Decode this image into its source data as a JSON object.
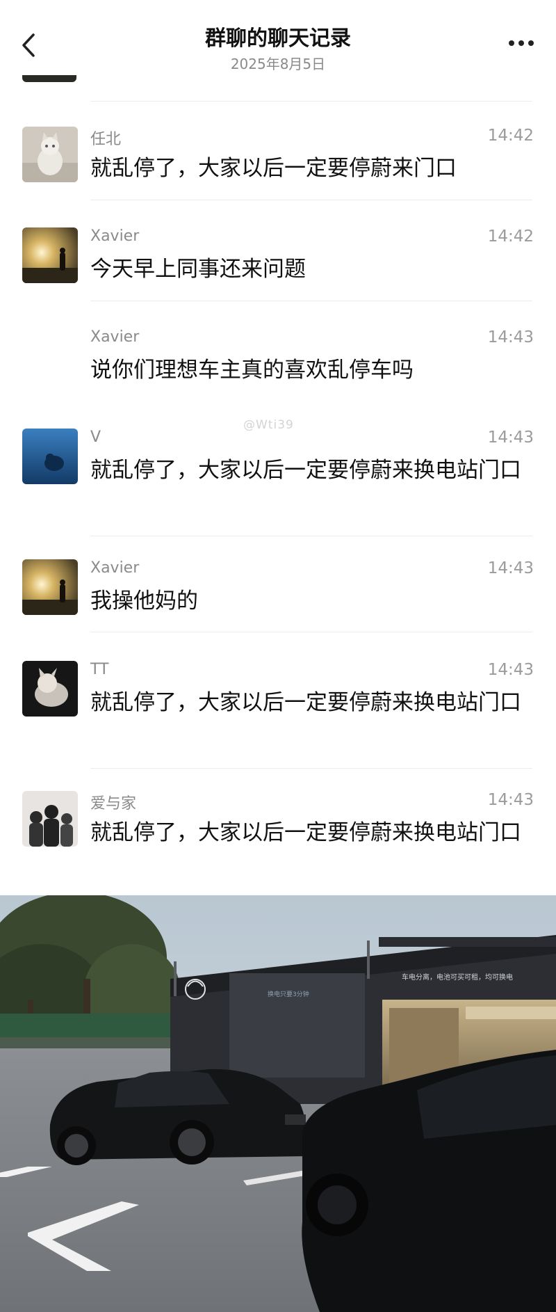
{
  "header": {
    "title": "群聊的聊天记录",
    "date": "2025年8月5日"
  },
  "watermark": "@Wti39",
  "messages": [
    {
      "sender": "任北",
      "time": "14:42",
      "text": "就乱停了，大家以后一定要停蔚来门口"
    },
    {
      "sender": "Xavier",
      "time": "14:42",
      "text": "今天早上同事还来问题"
    },
    {
      "sender": "Xavier",
      "time": "14:43",
      "text": "说你们理想车主真的喜欢乱停车吗"
    },
    {
      "sender": "V",
      "time": "14:43",
      "text": "就乱停了，大家以后一定要停蔚来换电站门口"
    },
    {
      "sender": "Xavier",
      "time": "14:43",
      "text": "我操他妈的"
    },
    {
      "sender": "TT",
      "time": "14:43",
      "text": "就乱停了，大家以后一定要停蔚来换电站门口"
    },
    {
      "sender": "爱与家",
      "time": "14:43",
      "text": "就乱停了，大家以后一定要停蔚来换电站门口"
    }
  ],
  "photo": {
    "station_sign": "车电分离，电池可买可租，均可换电",
    "station_screen": "换电只要3分钟",
    "brand_logo": "nio-logo"
  }
}
